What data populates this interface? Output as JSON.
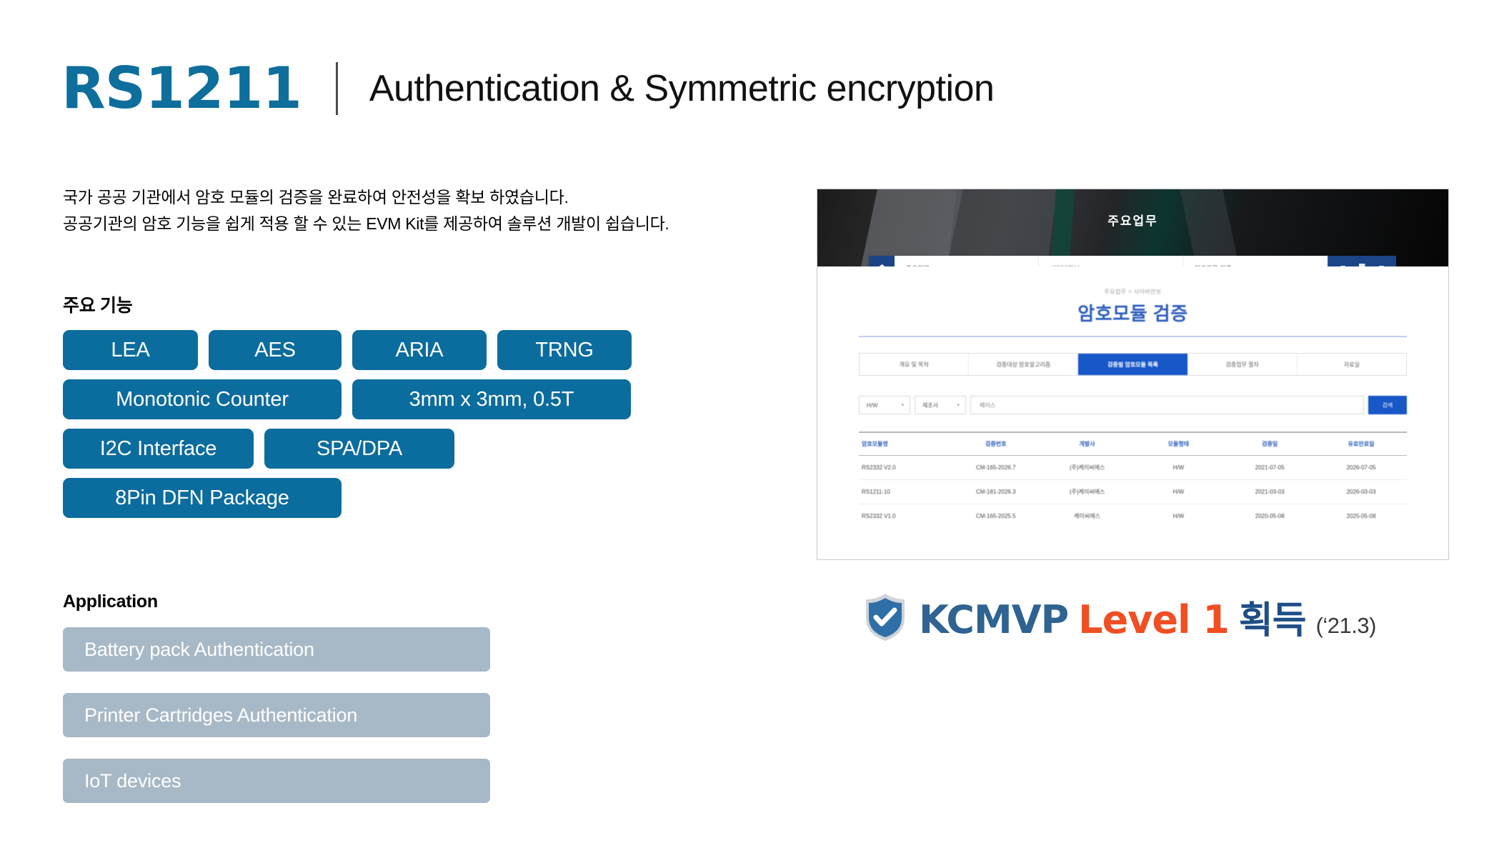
{
  "header": {
    "product_code": "RS1211",
    "subtitle": "Authentication & Symmetric encryption",
    "accent_color": "#0E6E9C"
  },
  "description": {
    "line1": "국가 공공 기관에서 암호 모듈의 검증을 완료하여 안전성을 확보 하였습니다.",
    "line2": "공공기관의 암호 기능을 쉽게 적용 할 수 있는 EVM Kit를 제공하여 솔루션 개발이 쉽습니다."
  },
  "features": {
    "heading": "주요 기능",
    "chip_color": "#0B6C9E",
    "rows": [
      [
        "LEA",
        "AES",
        "ARIA",
        "TRNG"
      ],
      [
        "Monotonic Counter",
        "3mm x 3mm, 0.5T"
      ],
      [
        "I2C Interface",
        "SPA/DPA"
      ],
      [
        "8Pin DFN Package"
      ]
    ]
  },
  "application": {
    "heading": "Application",
    "bar_color": "#A7B8C6",
    "items": [
      "Battery pack Authentication",
      "Printer Cartridges Authentication",
      "IoT devices"
    ]
  },
  "screenshot": {
    "hero_title": "주요업무",
    "navbar": {
      "home_icon": "home-icon",
      "selects": [
        "주요업무",
        "사이버안보",
        "암호모듈 검증"
      ]
    },
    "breadcrumb": "주요업무 > 사이버안보",
    "page_title": "암호모듈 검증",
    "tabs": [
      {
        "label": "개요 및 목적",
        "active": false
      },
      {
        "label": "검증대상 암호알고리즘",
        "active": false
      },
      {
        "label": "검증필 암호모듈 목록",
        "active": true
      },
      {
        "label": "검증업무 절차",
        "active": false
      },
      {
        "label": "자료실",
        "active": false
      }
    ],
    "search": {
      "select1": "H/W",
      "select2": "제조사",
      "input_value": "에이스",
      "button_label": "검색"
    },
    "table": {
      "headers": [
        "암호모듈명",
        "검증번호",
        "개발사",
        "모듈형태",
        "검증일",
        "유효만료일"
      ],
      "rows": [
        [
          "RS2332 V2.0",
          "CM-165-2026.7",
          "(주)케이씨에스",
          "H/W",
          "2021-07-05",
          "2026-07-05"
        ],
        [
          "RS1211-10",
          "CM-181-2026.3",
          "(주)케이씨에스",
          "H/W",
          "2021-03-03",
          "2026-03-03"
        ],
        [
          "RS2332 V1.0",
          "CM-165-2025.5",
          "케이씨에스",
          "H/W",
          "2020-05-08",
          "2025-05-08"
        ]
      ]
    }
  },
  "kcmvp": {
    "shield_icon": "shield-check-icon",
    "name": "KCMVP",
    "level": "Level 1",
    "korean": "획득",
    "date": "(‘21.3)",
    "name_color": "#2F6391",
    "level_color": "#F04E23",
    "korean_color": "#1F4E87"
  }
}
